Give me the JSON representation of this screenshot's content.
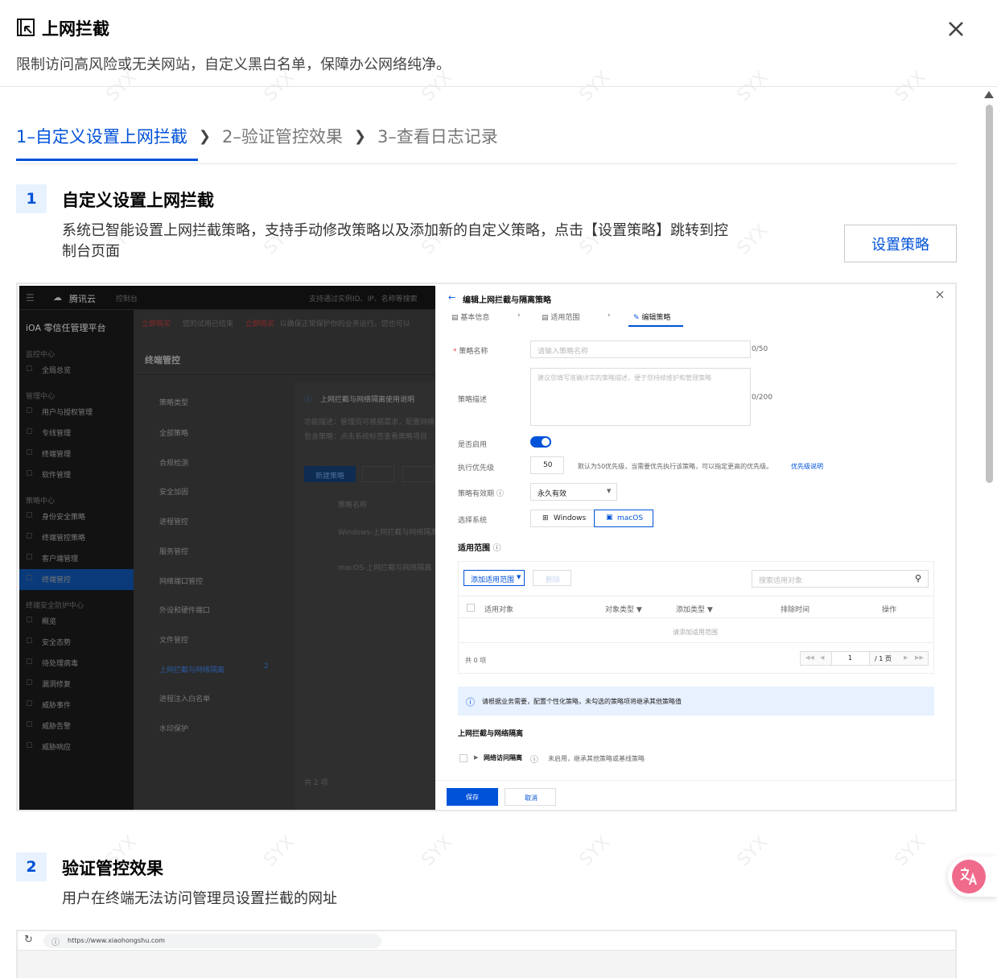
{
  "header": {
    "title": "上网拦截",
    "subtitle": "限制访问高风险或无关网站，自定义黑白名单，保障办公网络纯净。"
  },
  "steps": [
    {
      "label": "1–自定义设置上网拦截",
      "active": true
    },
    {
      "label": "2–验证管控效果",
      "active": false
    },
    {
      "label": "3–查看日志记录",
      "active": false
    }
  ],
  "section1": {
    "number": "1",
    "title": "自定义设置上网拦截",
    "desc_line1": "系统已智能设置上网拦截策略，支持手动修改策略以及添加新的自定义策略，点击【设置策略】跳转到控",
    "desc_line2": "制台页面",
    "button": "设置策略"
  },
  "section2": {
    "number": "2",
    "title": "验证管控效果",
    "desc": "用户在终端无法访问管理员设置拦截的网址"
  },
  "console": {
    "brand": "腾讯云",
    "home": "控制台",
    "platform": "iOA 零信任管理平台",
    "search": "支持通过实例ID、IP、名称等搜索",
    "notice_a": "立即购买",
    "notice_b": "您的试用已结束",
    "notice_c": "立即购买",
    "notice_d": "以确保正常保护你的业务运行。您也可以",
    "page_title": "终端管控",
    "side_groups": [
      {
        "label": "监控中心",
        "items": [
          "全局总览"
        ]
      },
      {
        "label": "管理中心",
        "items": [
          "用户与授权管理",
          "专线管理",
          "终端管理",
          "软件管理"
        ]
      },
      {
        "label": "策略中心",
        "items": [
          "身份安全策略",
          "终端管控策略",
          "客户端管理",
          "终端管控"
        ]
      },
      {
        "label": "终端安全防护中心",
        "items": [
          "概览",
          "安全态势",
          "待处理病毒",
          "漏洞修复",
          "威胁事件",
          "威胁告警",
          "威胁响应"
        ]
      }
    ],
    "policy_types_header": "策略类型",
    "policy_types": [
      "全部策略",
      "合规检测",
      "安全加固",
      "进程管控",
      "服务管控",
      "网络端口管控",
      "外设和硬件端口",
      "文件管控",
      "上网拦截与网络隔离",
      "进程注入白名单",
      "水印保护"
    ],
    "policy_count": "2",
    "info_title": "上网拦截与网络隔离使用说明",
    "info_line1": "功能描述：管理员可根据需求，配置网络",
    "info_line2": "包含策略：点击系统标签查看策略项目",
    "new_policy": "新建策略",
    "col_name": "策略名称",
    "row1": "Windows-上网拦截与网络隔离",
    "row2": "macOS-上网拦截与网络隔离",
    "total": "共 2 项"
  },
  "editor": {
    "title": "编辑上网拦截与隔离策略",
    "tabs": [
      "基本信息",
      "适用范围",
      "编辑策略"
    ],
    "name_label": "策略名称",
    "name_placeholder": "请输入策略名称",
    "name_count": "0/50",
    "desc_label": "策略描述",
    "desc_placeholder": "建议您填写准确详实的策略描述，便于您持续维护和管理策略",
    "desc_count": "0/200",
    "enable_label": "是否启用",
    "priority_label": "执行优先级",
    "priority_value": "50",
    "priority_hint": "默认为50优先级，当需要优先执行该策略，可以指定更高的优先级。",
    "priority_link": "优先级说明",
    "validity_label": "策略有效期",
    "validity_value": "永久有效",
    "os_label": "选择系统",
    "os_windows": "Windows",
    "os_macos": "macOS",
    "scope_title": "适用范围",
    "add_scope": "添加适用范围",
    "delete": "删除",
    "search_placeholder": "搜索适用对象",
    "columns": [
      "适用对象",
      "对象类型",
      "添加类型",
      "排除时间",
      "操作"
    ],
    "empty": "请添加适用范围",
    "total": "共 0 项",
    "page_current": "1",
    "page_total": "/ 1 页",
    "tip": "请根据业务需要，配置个性化策略，未勾选的策略项将继承其他策略值",
    "section_title": "上网拦截与网络隔离",
    "item_label": "网络访问隔离",
    "item_hint": "未启用，继承其他策略或基线策略",
    "save": "保存",
    "cancel": "取消"
  },
  "browser": {
    "url": "https://www.xiaohongshu.com"
  },
  "colors": {
    "accent": "#0052d9",
    "toggle": "#0052d9",
    "floating": "#f06a8c"
  }
}
